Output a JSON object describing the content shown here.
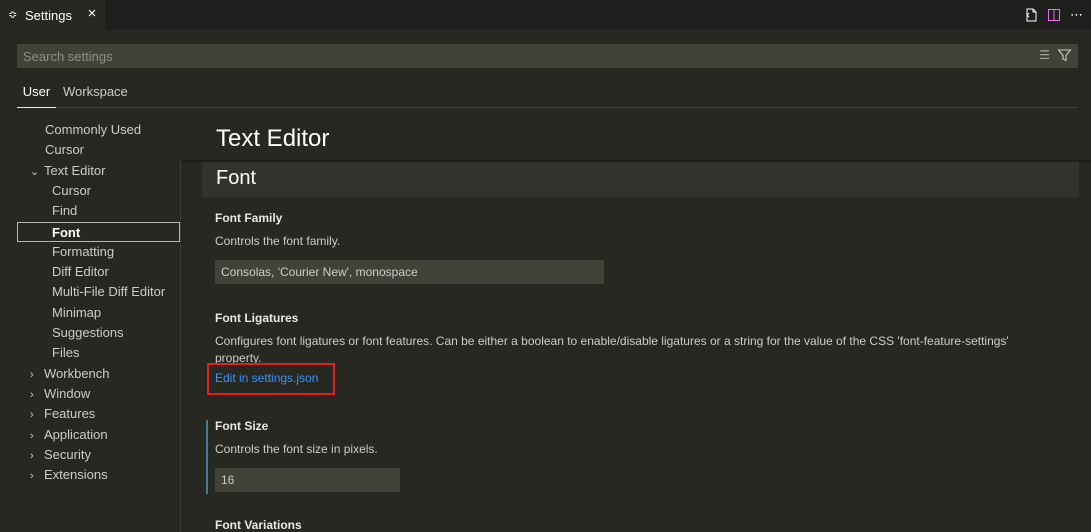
{
  "tab": {
    "label": "Settings"
  },
  "search": {
    "placeholder": "Search settings"
  },
  "scopes": {
    "user": "User",
    "workspace": "Workspace"
  },
  "toc": [
    {
      "label": "Commonly Used",
      "level": 0,
      "chevron": ""
    },
    {
      "label": "Cursor",
      "level": 0,
      "chevron": ""
    },
    {
      "label": "Text Editor",
      "level": 0,
      "chevron": "expanded"
    },
    {
      "label": "Cursor",
      "level": 1,
      "chevron": ""
    },
    {
      "label": "Find",
      "level": 1,
      "chevron": ""
    },
    {
      "label": "Font",
      "level": 1,
      "chevron": "",
      "selected": true
    },
    {
      "label": "Formatting",
      "level": 1,
      "chevron": ""
    },
    {
      "label": "Diff Editor",
      "level": 1,
      "chevron": ""
    },
    {
      "label": "Multi-File Diff Editor",
      "level": 1,
      "chevron": ""
    },
    {
      "label": "Minimap",
      "level": 1,
      "chevron": ""
    },
    {
      "label": "Suggestions",
      "level": 1,
      "chevron": ""
    },
    {
      "label": "Files",
      "level": 1,
      "chevron": ""
    },
    {
      "label": "Workbench",
      "level": 0,
      "chevron": "collapsed"
    },
    {
      "label": "Window",
      "level": 0,
      "chevron": "collapsed"
    },
    {
      "label": "Features",
      "level": 0,
      "chevron": "collapsed"
    },
    {
      "label": "Application",
      "level": 0,
      "chevron": "collapsed"
    },
    {
      "label": "Security",
      "level": 0,
      "chevron": "collapsed"
    },
    {
      "label": "Extensions",
      "level": 0,
      "chevron": "collapsed"
    }
  ],
  "main": {
    "section_title": "Text Editor",
    "subsection_title": "Font",
    "font_family": {
      "title": "Font Family",
      "description": "Controls the font family.",
      "value": "Consolas, 'Courier New', monospace"
    },
    "font_ligatures": {
      "title": "Font Ligatures",
      "description": "Configures font ligatures or font features. Can be either a boolean to enable/disable ligatures or a string for the value of the CSS 'font-feature-settings' property.",
      "link": "Edit in settings.json"
    },
    "font_size": {
      "title": "Font Size",
      "description": "Controls the font size in pixels.",
      "value": "16"
    },
    "font_variations": {
      "title": "Font Variations"
    }
  },
  "colors": {
    "background": "#272822",
    "accent_link": "#3794ff",
    "highlight": "#e61e1e"
  }
}
